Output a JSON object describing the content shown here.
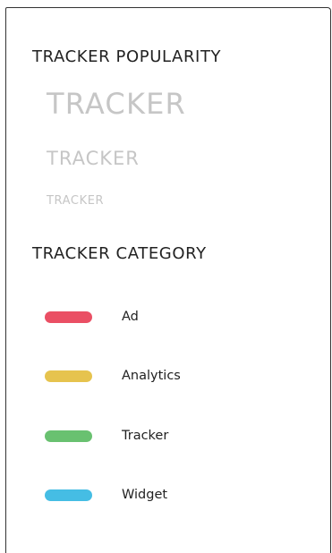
{
  "popularity": {
    "heading": "TRACKER POPULARITY",
    "levels": [
      {
        "label": "TRACKER"
      },
      {
        "label": "TRACKER"
      },
      {
        "label": "TRACKER"
      }
    ]
  },
  "category": {
    "heading": "TRACKER CATEGORY",
    "items": [
      {
        "label": "Ad",
        "color": "#ea4f64"
      },
      {
        "label": "Analytics",
        "color": "#e6c34e"
      },
      {
        "label": "Tracker",
        "color": "#69c170"
      },
      {
        "label": "Widget",
        "color": "#45bde4"
      }
    ]
  }
}
